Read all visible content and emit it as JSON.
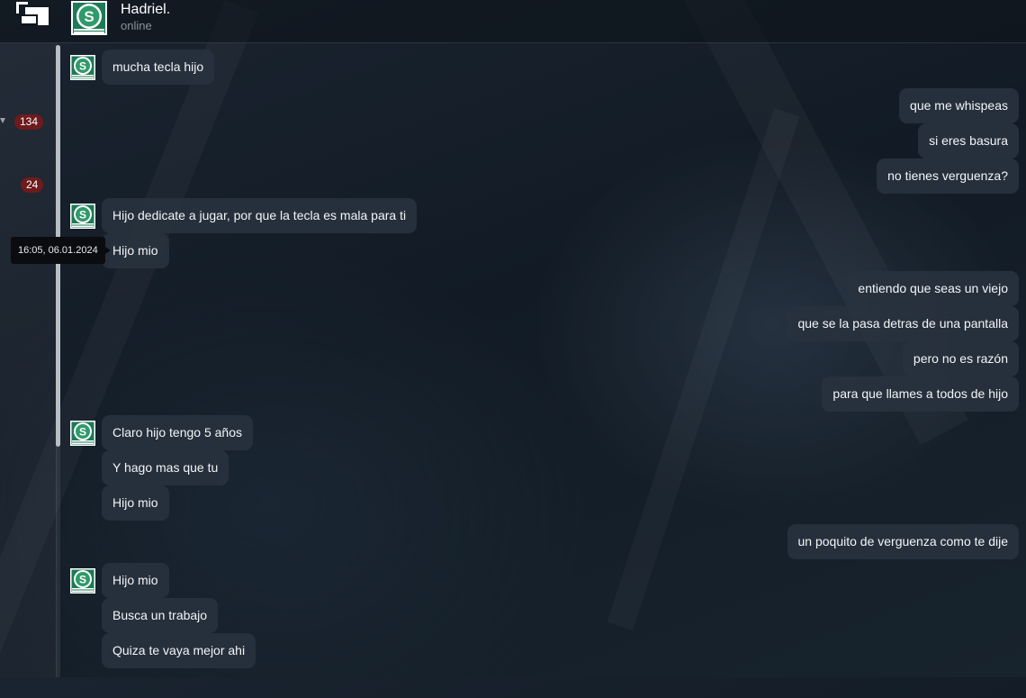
{
  "contact": {
    "name": "Hadriel.",
    "status": "online"
  },
  "sidebar": {
    "badges": [
      "134",
      "24"
    ]
  },
  "tooltip": {
    "timestamp": "16:05, 06.01.2024"
  },
  "messages": [
    {
      "dir": "in",
      "avatar": true,
      "text": "mucha tecla hijo"
    },
    {
      "dir": "out",
      "avatar": false,
      "text": "que me whispeas"
    },
    {
      "dir": "out",
      "avatar": false,
      "text": "si eres basura"
    },
    {
      "dir": "out",
      "avatar": false,
      "text": "no tienes verguenza?"
    },
    {
      "dir": "in",
      "avatar": true,
      "text": "Hijo dedicate a jugar, por que la tecla es mala para ti"
    },
    {
      "dir": "in",
      "avatar": false,
      "text": "Hijo mio"
    },
    {
      "dir": "out",
      "avatar": false,
      "text": "entiendo que seas un viejo"
    },
    {
      "dir": "out",
      "avatar": false,
      "text": "que se la pasa detras de una pantalla"
    },
    {
      "dir": "out",
      "avatar": false,
      "text": "pero no es razón"
    },
    {
      "dir": "out",
      "avatar": false,
      "text": "para que llames a todos de hijo"
    },
    {
      "dir": "in",
      "avatar": true,
      "text": "Claro hijo tengo 5 años"
    },
    {
      "dir": "in",
      "avatar": false,
      "text": "Y hago mas que tu"
    },
    {
      "dir": "in",
      "avatar": false,
      "text": "Hijo mio"
    },
    {
      "dir": "out",
      "avatar": false,
      "text": "un poquito de verguenza como te dije"
    },
    {
      "dir": "in",
      "avatar": true,
      "text": "Hijo mio"
    },
    {
      "dir": "in",
      "avatar": false,
      "text": "Busca un trabajo"
    },
    {
      "dir": "in",
      "avatar": false,
      "text": "Quiza te vaya mejor ahi"
    }
  ],
  "colors": {
    "bubble": "#28323e",
    "badge": "#6e1b1d",
    "avatar_green": "#2f9a6a"
  },
  "icons": {
    "back": "back-arrow-icon",
    "avatar": "league-emblem-icon"
  }
}
